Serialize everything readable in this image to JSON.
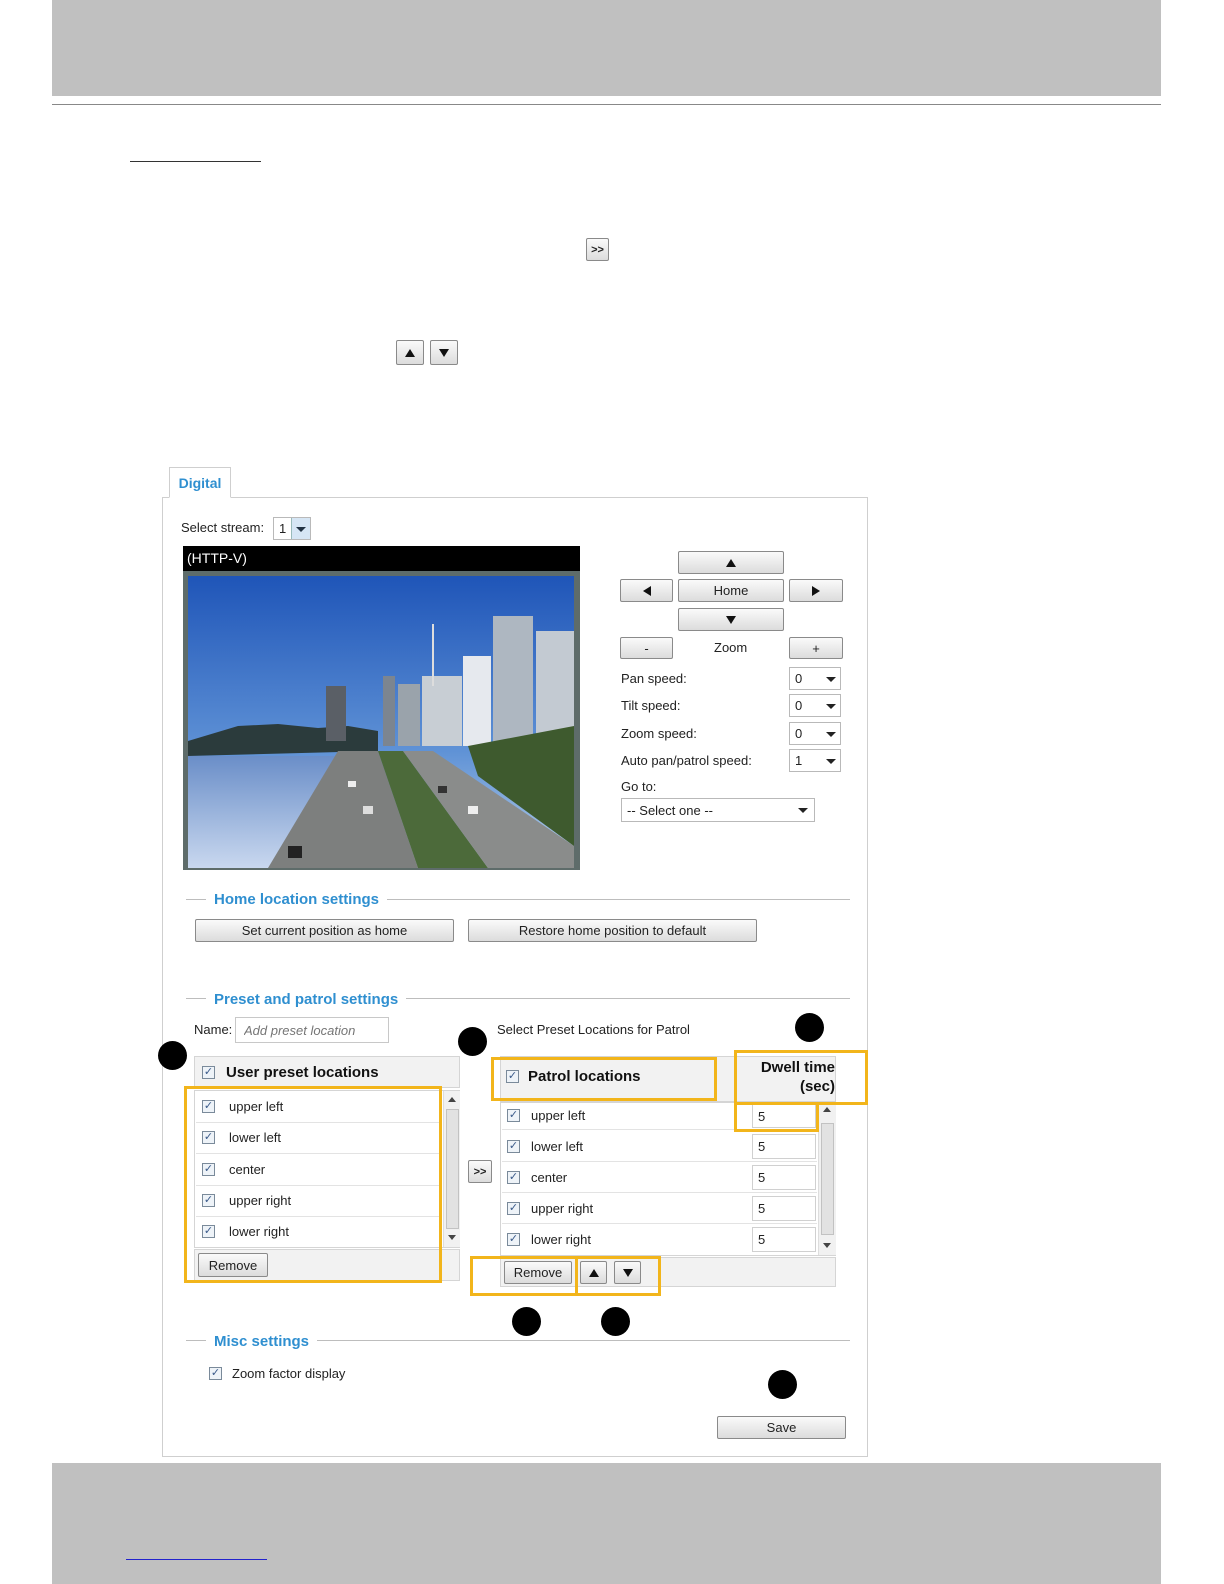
{
  "page": {
    "move_button_label": ">>",
    "up_button_icon": "triangle-up",
    "down_button_icon": "triangle-down",
    "accent_color": "#f2b51b",
    "section_color": "#2f8fd0"
  },
  "tab": {
    "label": "Digital"
  },
  "stream": {
    "label": "Select stream:",
    "value": "1"
  },
  "video": {
    "title": "(HTTP-V)"
  },
  "ptz": {
    "up_icon": "triangle-up",
    "down_icon": "triangle-down",
    "left_icon": "triangle-left",
    "right_icon": "triangle-right",
    "home_label": "Home",
    "zoom_minus": "-",
    "zoom_label": "Zoom",
    "zoom_plus": "+",
    "pan_speed_label": "Pan speed:",
    "pan_speed_value": "0",
    "tilt_speed_label": "Tilt speed:",
    "tilt_speed_value": "0",
    "zoom_speed_label": "Zoom speed:",
    "zoom_speed_value": "0",
    "auto_speed_label": "Auto pan/patrol speed:",
    "auto_speed_value": "1",
    "goto_label": "Go to:",
    "goto_value": "-- Select one --"
  },
  "home_settings": {
    "title": "Home location settings",
    "set_home_label": "Set current position as home",
    "restore_label": "Restore home position to default"
  },
  "preset": {
    "title": "Preset and patrol settings",
    "name_label": "Name:",
    "name_placeholder": "Add preset location",
    "select_for_patrol": "Select Preset Locations for Patrol",
    "user_header": "User preset locations",
    "user_items": [
      "upper left",
      "lower left",
      "center",
      "upper right",
      "lower right"
    ],
    "remove_label": "Remove",
    "move_label": ">>",
    "patrol_header": "Patrol locations",
    "dwell_header_1": "Dwell time",
    "dwell_header_2": "(sec)",
    "patrol_items": [
      {
        "name": "upper left",
        "dwell": "5"
      },
      {
        "name": "lower left",
        "dwell": "5"
      },
      {
        "name": "center",
        "dwell": "5"
      },
      {
        "name": "upper right",
        "dwell": "5"
      },
      {
        "name": "lower right",
        "dwell": "5"
      }
    ],
    "patrol_remove_label": "Remove"
  },
  "misc": {
    "title": "Misc settings",
    "zoom_factor_label": "Zoom factor display"
  },
  "save_label": "Save"
}
